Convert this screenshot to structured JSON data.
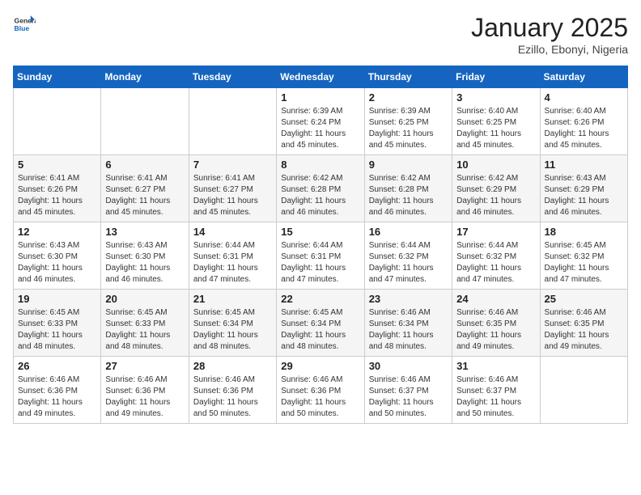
{
  "header": {
    "logo": {
      "general": "General",
      "blue": "Blue"
    },
    "title": "January 2025",
    "subtitle": "Ezillo, Ebonyi, Nigeria"
  },
  "weekdays": [
    "Sunday",
    "Monday",
    "Tuesday",
    "Wednesday",
    "Thursday",
    "Friday",
    "Saturday"
  ],
  "weeks": [
    [
      {
        "day": "",
        "info": ""
      },
      {
        "day": "",
        "info": ""
      },
      {
        "day": "",
        "info": ""
      },
      {
        "day": "1",
        "info": "Sunrise: 6:39 AM\nSunset: 6:24 PM\nDaylight: 11 hours\nand 45 minutes."
      },
      {
        "day": "2",
        "info": "Sunrise: 6:39 AM\nSunset: 6:25 PM\nDaylight: 11 hours\nand 45 minutes."
      },
      {
        "day": "3",
        "info": "Sunrise: 6:40 AM\nSunset: 6:25 PM\nDaylight: 11 hours\nand 45 minutes."
      },
      {
        "day": "4",
        "info": "Sunrise: 6:40 AM\nSunset: 6:26 PM\nDaylight: 11 hours\nand 45 minutes."
      }
    ],
    [
      {
        "day": "5",
        "info": "Sunrise: 6:41 AM\nSunset: 6:26 PM\nDaylight: 11 hours\nand 45 minutes."
      },
      {
        "day": "6",
        "info": "Sunrise: 6:41 AM\nSunset: 6:27 PM\nDaylight: 11 hours\nand 45 minutes."
      },
      {
        "day": "7",
        "info": "Sunrise: 6:41 AM\nSunset: 6:27 PM\nDaylight: 11 hours\nand 45 minutes."
      },
      {
        "day": "8",
        "info": "Sunrise: 6:42 AM\nSunset: 6:28 PM\nDaylight: 11 hours\nand 46 minutes."
      },
      {
        "day": "9",
        "info": "Sunrise: 6:42 AM\nSunset: 6:28 PM\nDaylight: 11 hours\nand 46 minutes."
      },
      {
        "day": "10",
        "info": "Sunrise: 6:42 AM\nSunset: 6:29 PM\nDaylight: 11 hours\nand 46 minutes."
      },
      {
        "day": "11",
        "info": "Sunrise: 6:43 AM\nSunset: 6:29 PM\nDaylight: 11 hours\nand 46 minutes."
      }
    ],
    [
      {
        "day": "12",
        "info": "Sunrise: 6:43 AM\nSunset: 6:30 PM\nDaylight: 11 hours\nand 46 minutes."
      },
      {
        "day": "13",
        "info": "Sunrise: 6:43 AM\nSunset: 6:30 PM\nDaylight: 11 hours\nand 46 minutes."
      },
      {
        "day": "14",
        "info": "Sunrise: 6:44 AM\nSunset: 6:31 PM\nDaylight: 11 hours\nand 47 minutes."
      },
      {
        "day": "15",
        "info": "Sunrise: 6:44 AM\nSunset: 6:31 PM\nDaylight: 11 hours\nand 47 minutes."
      },
      {
        "day": "16",
        "info": "Sunrise: 6:44 AM\nSunset: 6:32 PM\nDaylight: 11 hours\nand 47 minutes."
      },
      {
        "day": "17",
        "info": "Sunrise: 6:44 AM\nSunset: 6:32 PM\nDaylight: 11 hours\nand 47 minutes."
      },
      {
        "day": "18",
        "info": "Sunrise: 6:45 AM\nSunset: 6:32 PM\nDaylight: 11 hours\nand 47 minutes."
      }
    ],
    [
      {
        "day": "19",
        "info": "Sunrise: 6:45 AM\nSunset: 6:33 PM\nDaylight: 11 hours\nand 48 minutes."
      },
      {
        "day": "20",
        "info": "Sunrise: 6:45 AM\nSunset: 6:33 PM\nDaylight: 11 hours\nand 48 minutes."
      },
      {
        "day": "21",
        "info": "Sunrise: 6:45 AM\nSunset: 6:34 PM\nDaylight: 11 hours\nand 48 minutes."
      },
      {
        "day": "22",
        "info": "Sunrise: 6:45 AM\nSunset: 6:34 PM\nDaylight: 11 hours\nand 48 minutes."
      },
      {
        "day": "23",
        "info": "Sunrise: 6:46 AM\nSunset: 6:34 PM\nDaylight: 11 hours\nand 48 minutes."
      },
      {
        "day": "24",
        "info": "Sunrise: 6:46 AM\nSunset: 6:35 PM\nDaylight: 11 hours\nand 49 minutes."
      },
      {
        "day": "25",
        "info": "Sunrise: 6:46 AM\nSunset: 6:35 PM\nDaylight: 11 hours\nand 49 minutes."
      }
    ],
    [
      {
        "day": "26",
        "info": "Sunrise: 6:46 AM\nSunset: 6:36 PM\nDaylight: 11 hours\nand 49 minutes."
      },
      {
        "day": "27",
        "info": "Sunrise: 6:46 AM\nSunset: 6:36 PM\nDaylight: 11 hours\nand 49 minutes."
      },
      {
        "day": "28",
        "info": "Sunrise: 6:46 AM\nSunset: 6:36 PM\nDaylight: 11 hours\nand 50 minutes."
      },
      {
        "day": "29",
        "info": "Sunrise: 6:46 AM\nSunset: 6:36 PM\nDaylight: 11 hours\nand 50 minutes."
      },
      {
        "day": "30",
        "info": "Sunrise: 6:46 AM\nSunset: 6:37 PM\nDaylight: 11 hours\nand 50 minutes."
      },
      {
        "day": "31",
        "info": "Sunrise: 6:46 AM\nSunset: 6:37 PM\nDaylight: 11 hours\nand 50 minutes."
      },
      {
        "day": "",
        "info": ""
      }
    ]
  ]
}
